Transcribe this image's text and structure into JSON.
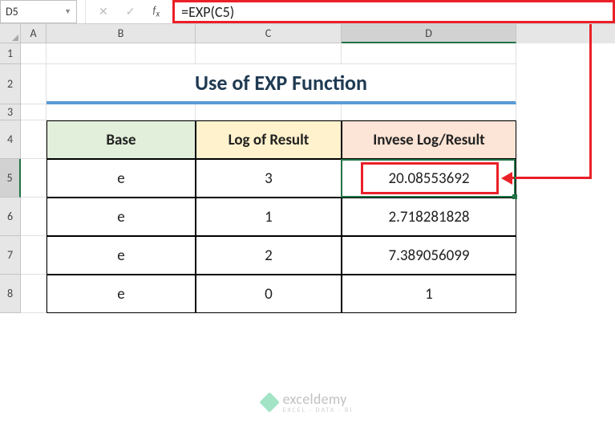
{
  "nameBox": "D5",
  "formula": "=EXP(C5)",
  "columns": [
    "A",
    "B",
    "C",
    "D"
  ],
  "rowNumbers": [
    "1",
    "2",
    "3",
    "4",
    "5",
    "6",
    "7",
    "8"
  ],
  "title": "Use of EXP Function",
  "headers": {
    "base": "Base",
    "log": "Log of Result",
    "inv": "Invese Log/Result"
  },
  "rows": [
    {
      "base": "e",
      "log": "3",
      "inv": "20.08553692"
    },
    {
      "base": "e",
      "log": "1",
      "inv": "2.718281828"
    },
    {
      "base": "e",
      "log": "2",
      "inv": "7.389056099"
    },
    {
      "base": "e",
      "log": "0",
      "inv": "1"
    }
  ],
  "watermark": {
    "name": "exceldemy",
    "tag": "EXCEL · DATA · BI"
  }
}
